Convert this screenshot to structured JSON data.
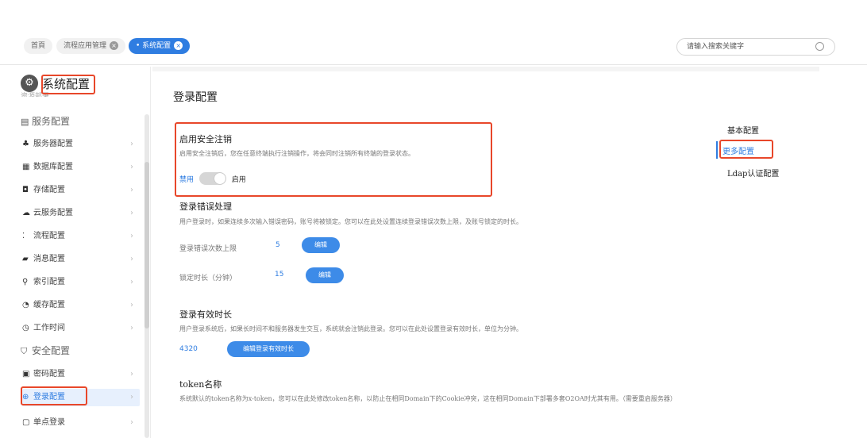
{
  "tabs": [
    {
      "label": "首頁",
      "closable": false
    },
    {
      "label": "流程应用管理",
      "closable": true
    },
    {
      "label": "• 系统配置",
      "closable": true,
      "active": true
    }
  ],
  "search": {
    "placeholder": "请输入搜索关键字",
    "value": ""
  },
  "sidebar": {
    "title": "系统配置",
    "cut_item": "资源部署",
    "groups": [
      {
        "label": "服务配置",
        "icon": "document-icon"
      },
      {
        "label": "安全配置",
        "icon": "shield-icon"
      }
    ],
    "items": [
      {
        "label": "服务器配置",
        "icon": "server-icon"
      },
      {
        "label": "数据库配置",
        "icon": "database-icon"
      },
      {
        "label": "存储配置",
        "icon": "storage-icon"
      },
      {
        "label": "云服务配置",
        "icon": "cloud-icon"
      },
      {
        "label": "流程配置",
        "icon": "flow-icon"
      },
      {
        "label": "消息配置",
        "icon": "message-icon"
      },
      {
        "label": "索引配置",
        "icon": "search-icon"
      },
      {
        "label": "缓存配置",
        "icon": "cache-icon"
      },
      {
        "label": "工作时间",
        "icon": "clock-icon"
      },
      {
        "label": "密码配置",
        "icon": "lock-icon"
      },
      {
        "label": "登录配置",
        "icon": "login-icon",
        "selected": true
      },
      {
        "label": "单点登录",
        "icon": "sso-icon"
      }
    ]
  },
  "main": {
    "title": "登录配置",
    "logout": {
      "title": "启用安全注销",
      "desc": "启用安全注销后，您在任意终端执行注销操作，将会同时注销所有终端的登录状态。",
      "off_label": "禁用",
      "on_label": "启用",
      "enabled": true
    },
    "login_error": {
      "title": "登录错误处理",
      "desc": "用户登录时，如果连续多次输入错误密码，账号将被锁定。您可以在此处设置连续登录错误次数上限，及账号锁定的时长。",
      "limit_label": "登录错误次数上限",
      "limit_value": "5",
      "edit_label": "编辑",
      "lock_label": "锁定时长（分钟）",
      "lock_value": "15",
      "edit2_label": "编辑"
    },
    "login_duration": {
      "title": "登录有效时长",
      "desc": "用户登录系统后，如果长时间不和服务器发生交互，系统就会注销此登录。您可以在此处设置登录有效时长，单位为分钟。",
      "value": "4320",
      "button": "编辑登录有效时长"
    },
    "token": {
      "title": "token名称",
      "desc": "系统默认的token名称为x-token，您可以在此处修改token名称，以防止在相同Domain下的Cookie冲突，这在相同Domain下部署多套O2OA时尤其有用。（需要重启服务器）"
    }
  },
  "anchor_nav": {
    "items": [
      "基本配置",
      "更多配置",
      "Ldap认证配置"
    ],
    "current": "更多配置"
  },
  "colors": {
    "accent": "#2f7de1",
    "highlight": "#e8472a"
  }
}
